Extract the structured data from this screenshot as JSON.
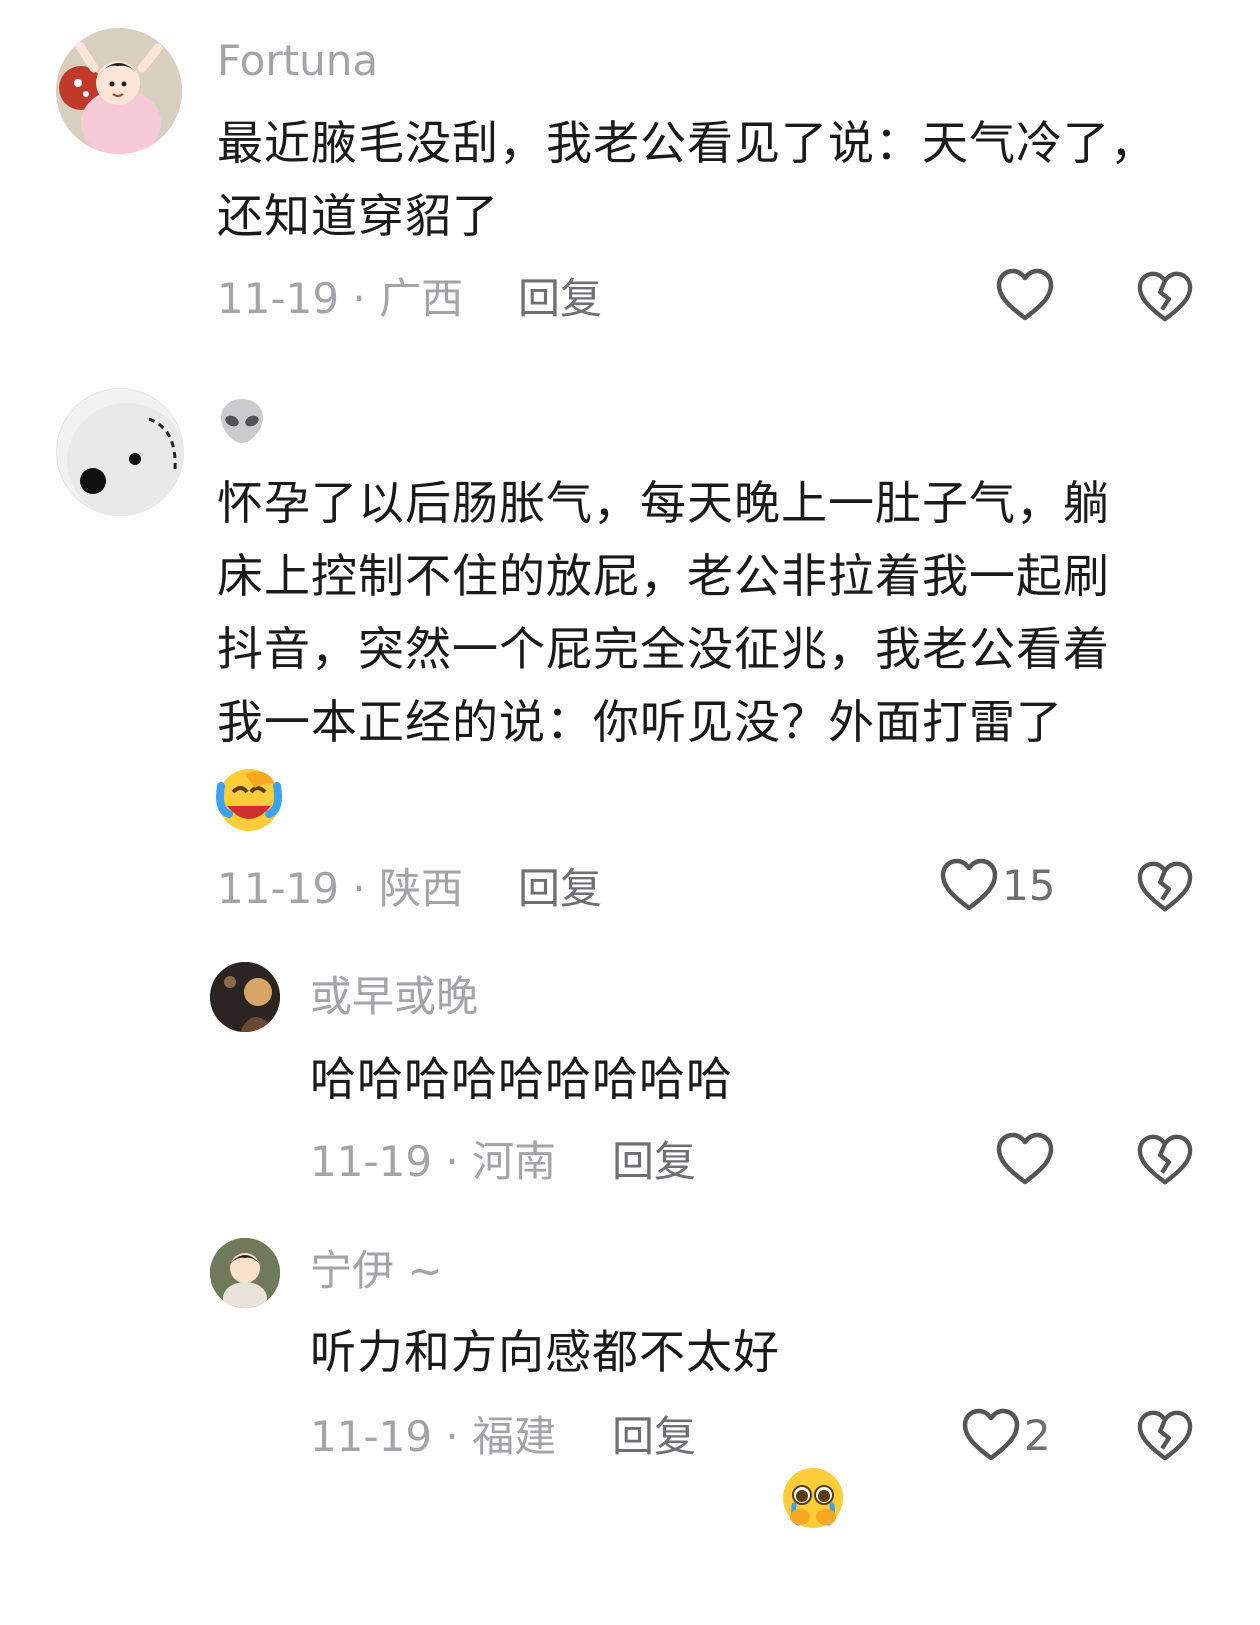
{
  "comments": [
    {
      "username": "Fortuna",
      "text": "最近腋毛没刮，我老公看见了说：天气冷了，\n还知道穿貂了",
      "date_region": "11-19 · 广西",
      "reply_label": "回复",
      "like_count": ""
    },
    {
      "username_icon": "alien-icon",
      "text": "怀孕了以后肠胀气，每天晚上一肚子气，躺\n床上控制不住的放屁，老公非拉着我一起刷\n抖音，突然一个屁完全没征兆，我老公看着\n我一本正经的说：你听见没？外面打雷了",
      "trailing_emoji": "crying-laughing-emoji",
      "date_region": "11-19 · 陕西",
      "reply_label": "回复",
      "like_count": "15",
      "replies": [
        {
          "username": "或早或晚",
          "text": "哈哈哈哈哈哈哈哈哈",
          "date_region": "11-19 · 河南",
          "reply_label": "回复",
          "like_count": ""
        },
        {
          "username": "宁伊 ~",
          "text": "听力和方向感都不太好",
          "trailing_emoji": "pleading-face-emoji",
          "date_region": "11-19 · 福建",
          "reply_label": "回复",
          "like_count": "2"
        }
      ]
    }
  ]
}
